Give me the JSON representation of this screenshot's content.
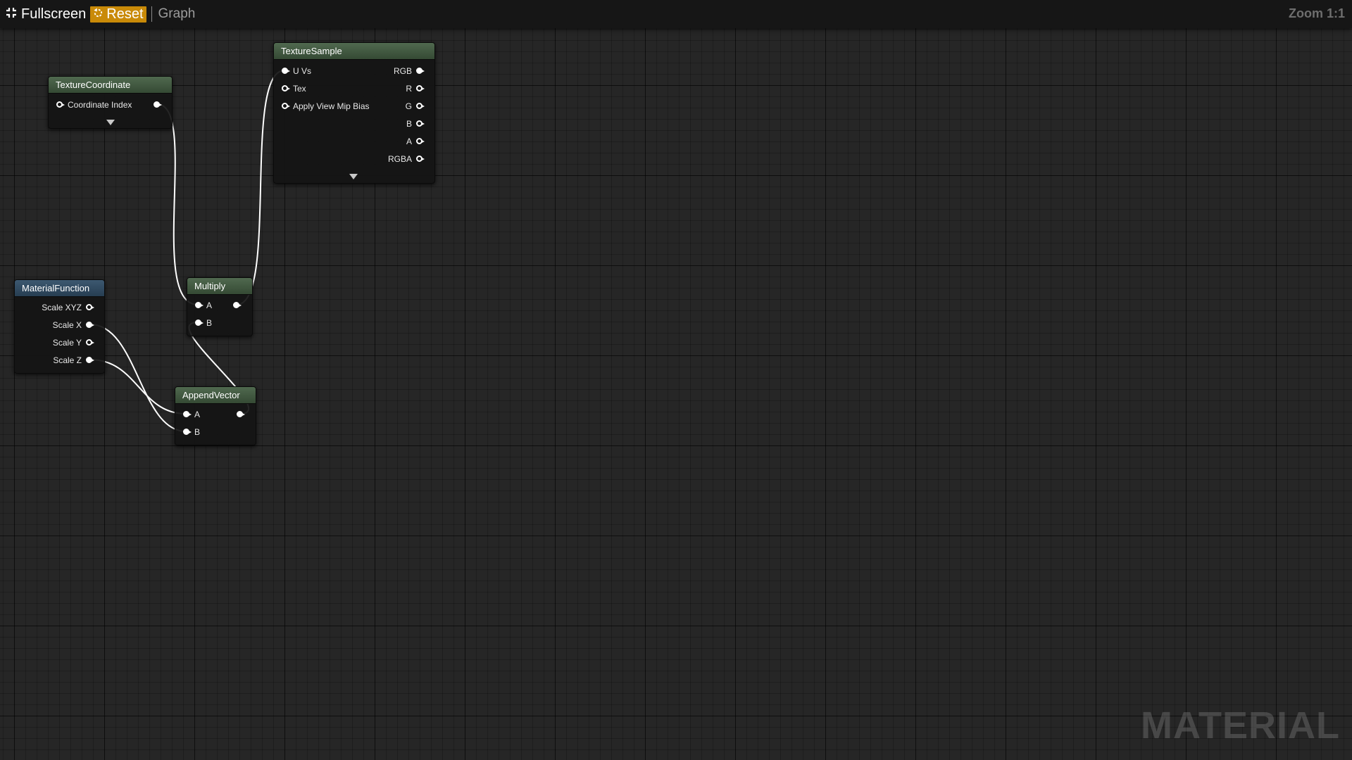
{
  "toolbar": {
    "fullscreen_label": "Fullscreen",
    "reset_label": "Reset",
    "graph_label": "Graph",
    "zoom_label": "Zoom 1:1"
  },
  "watermark": "MATERIAL",
  "colors": {
    "canvas_bg": "#262626",
    "reset_bg": "#c98a08",
    "header_green": "#4b6349",
    "header_blue": "#3a566e",
    "wire": "#ffffff"
  },
  "nodes": {
    "texture_coordinate": {
      "title": "TextureCoordinate",
      "inputs": [
        {
          "label": "Coordinate Index",
          "connected": false
        }
      ],
      "outputs": [
        {
          "label": "",
          "connected": true
        }
      ]
    },
    "texture_sample": {
      "title": "TextureSample",
      "inputs": [
        {
          "label": "U Vs",
          "connected": true
        },
        {
          "label": "Tex",
          "connected": false
        },
        {
          "label": "Apply View Mip Bias",
          "connected": false
        }
      ],
      "outputs": [
        {
          "label": "RGB",
          "connected": true
        },
        {
          "label": "R",
          "connected": false
        },
        {
          "label": "G",
          "connected": false
        },
        {
          "label": "B",
          "connected": false
        },
        {
          "label": "A",
          "connected": false
        },
        {
          "label": "RGBA",
          "connected": false
        }
      ]
    },
    "material_function": {
      "title": "MaterialFunction",
      "outputs": [
        {
          "label": "Scale XYZ",
          "connected": false
        },
        {
          "label": "Scale X",
          "connected": true
        },
        {
          "label": "Scale Y",
          "connected": false
        },
        {
          "label": "Scale Z",
          "connected": true
        }
      ]
    },
    "multiply": {
      "title": "Multiply",
      "inputs": [
        {
          "label": "A",
          "connected": true
        },
        {
          "label": "B",
          "connected": true
        }
      ],
      "outputs": [
        {
          "label": "",
          "connected": true
        }
      ]
    },
    "append_vector": {
      "title": "AppendVector",
      "inputs": [
        {
          "label": "A",
          "connected": true
        },
        {
          "label": "B",
          "connected": true
        }
      ],
      "outputs": [
        {
          "label": "",
          "connected": true
        }
      ]
    }
  },
  "connections": [
    {
      "from": "texture_coordinate.out0",
      "to": "multiply.in0"
    },
    {
      "from": "multiply.out0",
      "to": "texture_sample.in0"
    },
    {
      "from": "material_function.out1",
      "to": "append_vector.in1"
    },
    {
      "from": "material_function.out3",
      "to": "append_vector.in0"
    },
    {
      "from": "append_vector.out0",
      "to": "multiply.in1"
    }
  ]
}
